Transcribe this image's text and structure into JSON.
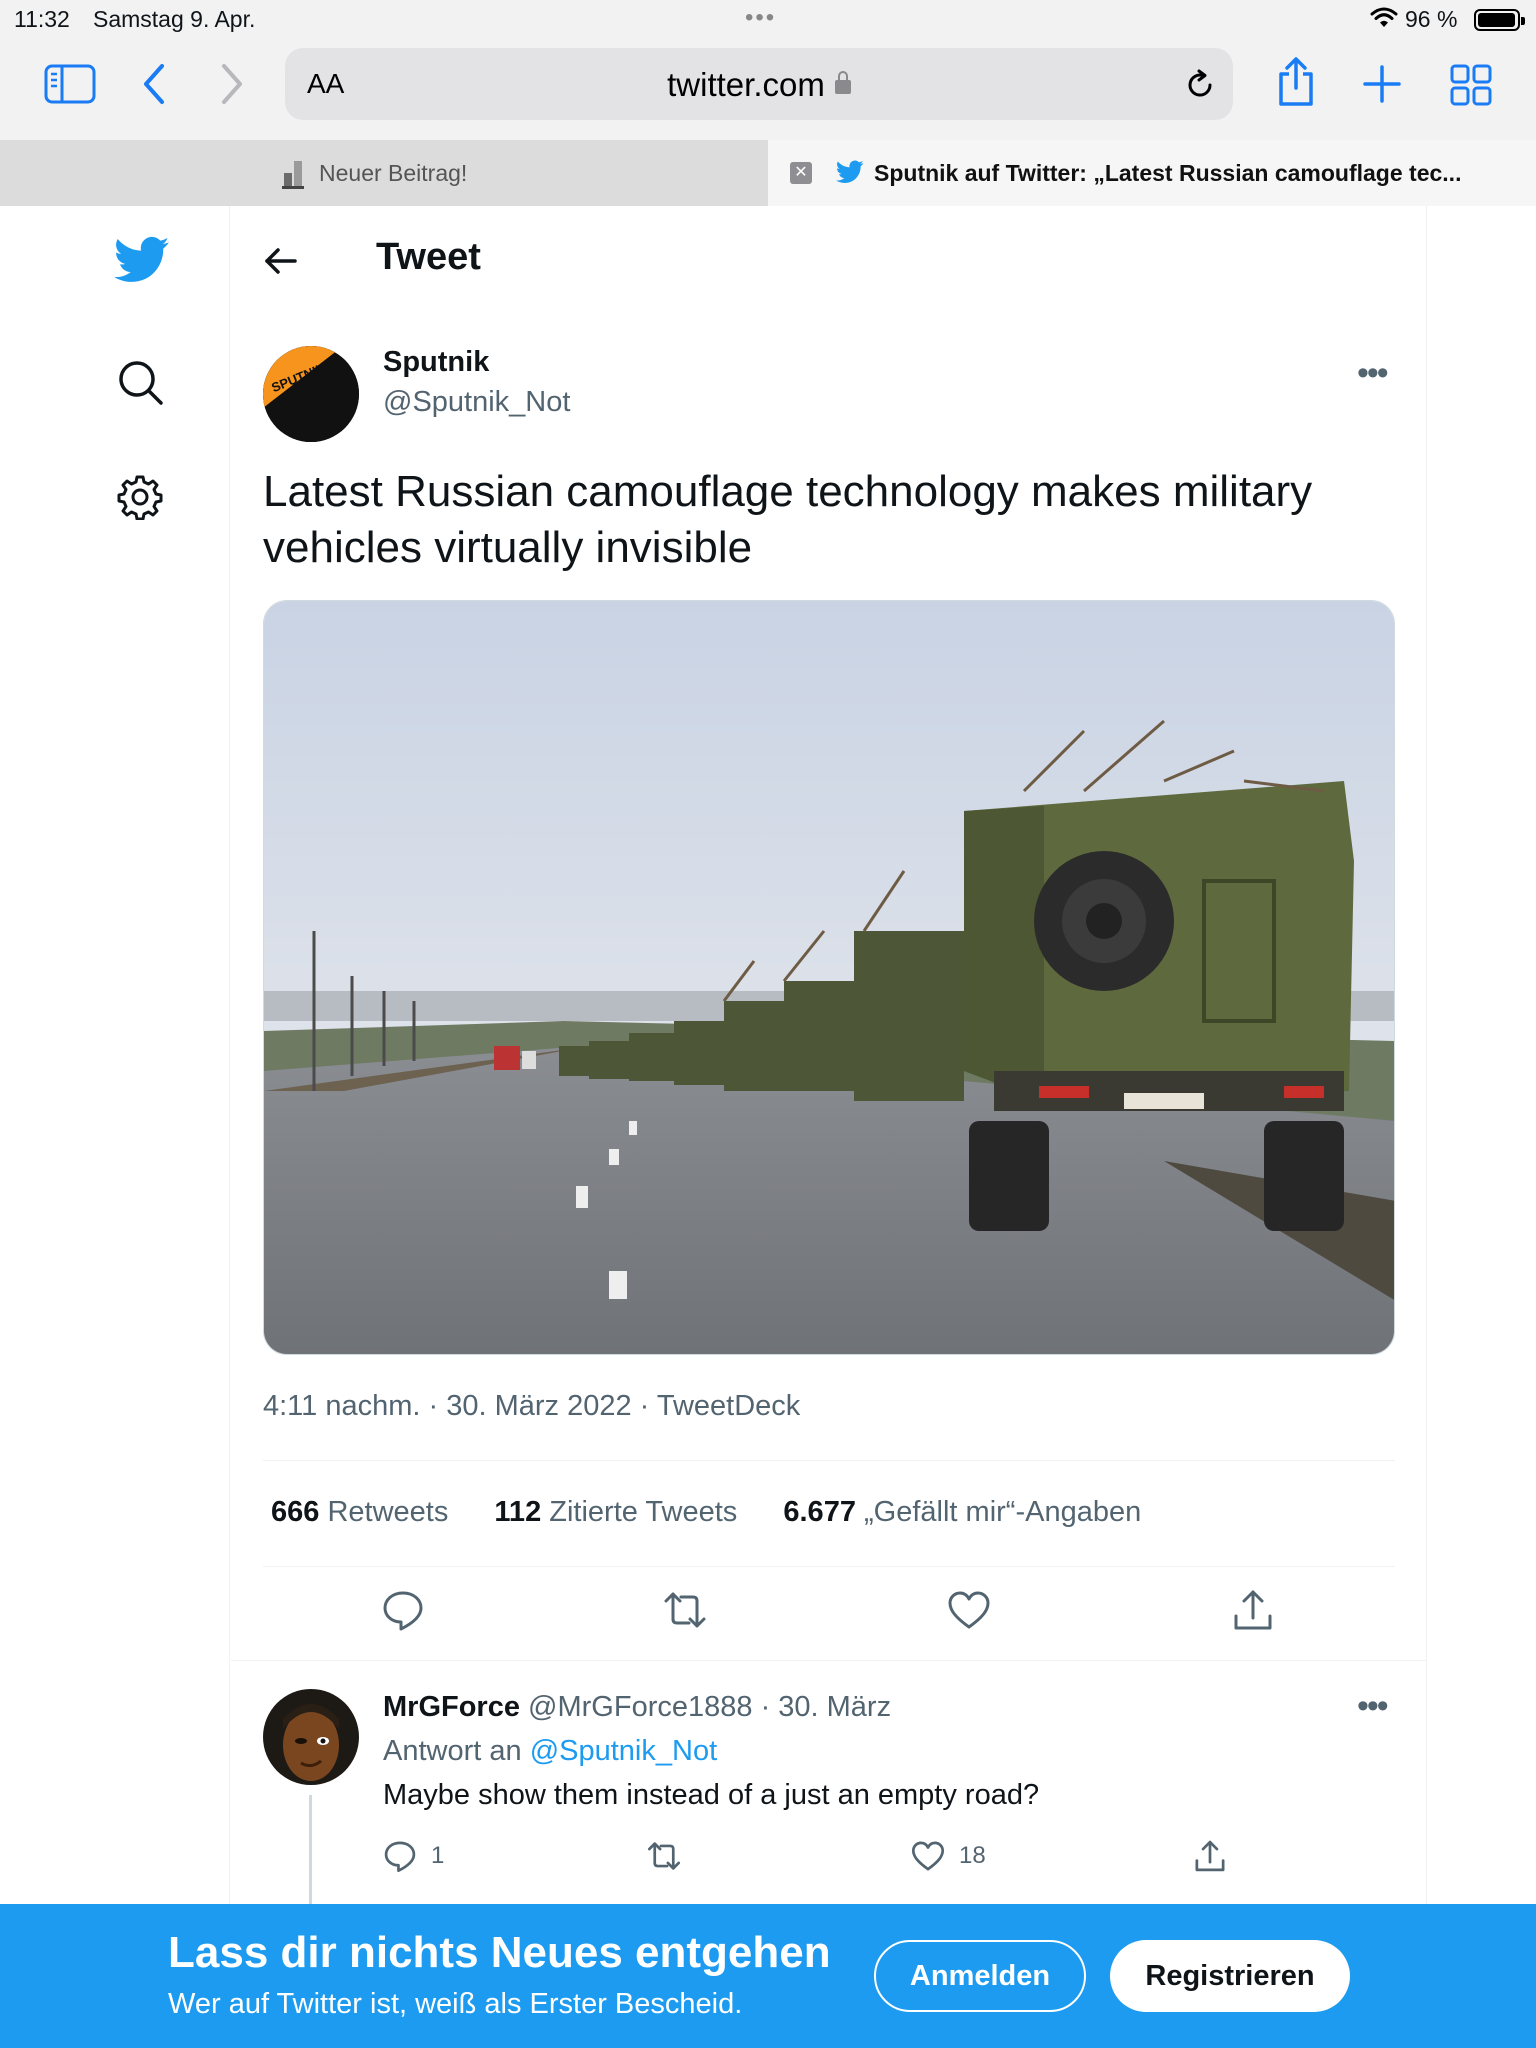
{
  "status_bar": {
    "time": "11:32",
    "date": "Samstag 9. Apr.",
    "battery": "96 %",
    "battery_level": 0.96
  },
  "browser": {
    "text_size_label": "AA",
    "url": "twitter.com",
    "tabs": [
      {
        "label": "Neuer Beitrag!",
        "active": false
      },
      {
        "label": "Sputnik auf Twitter: „Latest Russian camouflage tec...",
        "active": true
      }
    ],
    "accent_color": "#1a7cf5"
  },
  "twitter": {
    "brand_color": "#1d9bf0",
    "header_title": "Tweet",
    "tweet": {
      "author_name": "Sputnik",
      "author_handle": "@Sputnik_Not",
      "avatar_text": "SPUTNIK NOT",
      "text": "Latest Russian camouflage technology makes military vehicles virtually invisible",
      "timestamp": "4:11 nachm. · 30. März 2022 · TweetDeck",
      "stats": {
        "retweets_count": "666",
        "retweets_label": "Retweets",
        "quotes_count": "112",
        "quotes_label": "Zitierte Tweets",
        "likes_count": "6.677",
        "likes_label": "„Gefällt mir“-Angaben"
      },
      "actions": [
        "reply-icon",
        "retweet-icon",
        "like-icon",
        "share-icon"
      ]
    },
    "reply": {
      "author_name": "MrGForce",
      "author_handle": "@MrGForce1888",
      "date": "· 30. März",
      "reply_to_prefix": "Antwort an",
      "reply_to_handle": "@Sputnik_Not",
      "text": "Maybe show them instead of a just an empty road?",
      "reply_count": "1",
      "like_count": "18"
    },
    "banner": {
      "headline": "Lass dir nichts Neues entgehen",
      "subline": "Wer auf Twitter ist, weiß als Erster Bescheid.",
      "login_label": "Anmelden",
      "signup_label": "Registrieren"
    }
  }
}
